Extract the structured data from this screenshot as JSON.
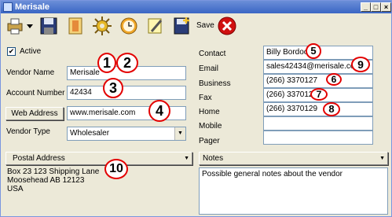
{
  "window": {
    "title": "Merisale"
  },
  "toolbar": {
    "save_label": "Save"
  },
  "form": {
    "active_label": "Active",
    "active_checked": true,
    "vendor_name_label": "Vendor Name",
    "vendor_name_value": "Merisale",
    "account_number_label": "Account Number",
    "account_number_value": "42434",
    "web_address_button": "Web Address",
    "web_address_value": "www.merisale.com",
    "vendor_type_label": "Vendor Type",
    "vendor_type_value": "Wholesaler",
    "postal_address_dropdown": "Postal Address",
    "postal_address_lines": [
      "Box 23 123 Shipping Lane",
      "Moosehead AB  12123",
      "USA"
    ],
    "notes_dropdown": "Notes",
    "notes_text": "Possible general notes about the vendor"
  },
  "contact": {
    "contact_label": "Contact",
    "contact_value": "Billy Bordoon",
    "email_label": "Email",
    "email_value": "sales42434@merisale.com",
    "business_label": "Business",
    "business_value": "(266) 3370127",
    "fax_label": "Fax",
    "fax_value": "(266) 3370128",
    "home_label": "Home",
    "home_value": "(266) 3370129",
    "mobile_label": "Mobile",
    "mobile_value": "",
    "pager_label": "Pager",
    "pager_value": ""
  },
  "callouts": {
    "c1": "1",
    "c2": "2",
    "c3": "3",
    "c4": "4",
    "c5": "5",
    "c6": "6",
    "c7": "7",
    "c8": "8",
    "c9": "9",
    "c10": "10"
  },
  "colors": {
    "callout_border": "#e30000",
    "title_bar": "#3a66c4"
  }
}
